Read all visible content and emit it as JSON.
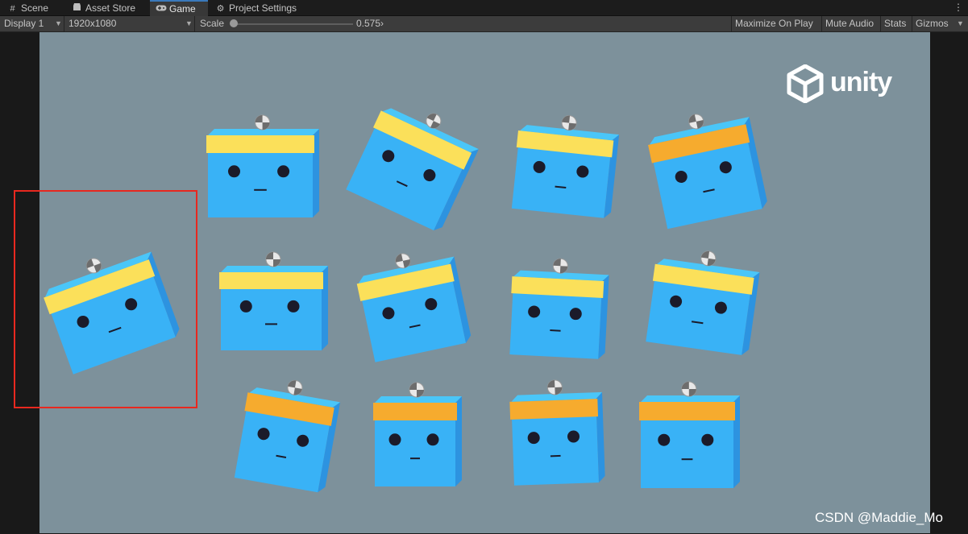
{
  "tabs": [
    {
      "label": "Scene",
      "icon": "grid-icon",
      "active": false
    },
    {
      "label": "Asset Store",
      "icon": "store-icon",
      "active": false
    },
    {
      "label": "Game",
      "icon": "gamepad-icon",
      "active": true
    },
    {
      "label": "Project Settings",
      "icon": "gear-icon",
      "active": false
    }
  ],
  "toolbar": {
    "display": "Display 1",
    "resolution": "1920x1080",
    "scale_label": "Scale",
    "scale_value": "0.575",
    "scale_fraction": 0.0,
    "maximize_on_play": "Maximize On Play",
    "mute_audio": "Mute Audio",
    "stats": "Stats",
    "gizmos": "Gizmos"
  },
  "game": {
    "logo_text": "unity",
    "watermark": "CSDN @Maddie_Mo",
    "colors": {
      "background": "#7d919b",
      "cube_blue": "#39b2f6",
      "cube_side": "#2d93e0",
      "band_yellow": "#fbe05a",
      "band_orange": "#f6ab2e",
      "highlight_box": "#e8281f"
    }
  }
}
